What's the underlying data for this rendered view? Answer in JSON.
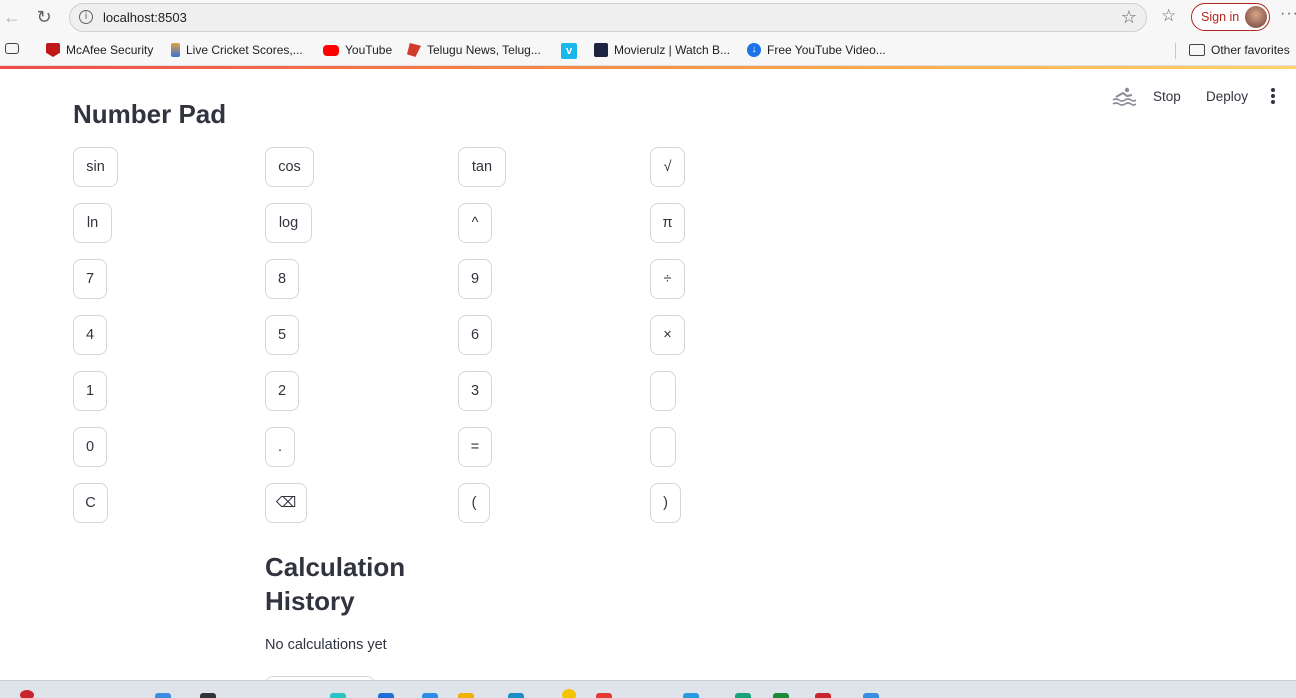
{
  "browser": {
    "url": "localhost:8503",
    "sign_in": "Sign in",
    "bookmarks": [
      {
        "label": "McAfee Security",
        "icon": "mcafee-icon",
        "color": "#c01818"
      },
      {
        "label": "Live Cricket Scores,...",
        "icon": "cricket-icon",
        "color": "#3b6fd8"
      },
      {
        "label": "YouTube",
        "icon": "youtube-icon",
        "color": "#ff0000"
      },
      {
        "label": "Telugu News, Telug...",
        "icon": "news-icon",
        "color": "#d23a2b"
      },
      {
        "label": "",
        "icon": "vimeo-icon",
        "color": "#1ab7ea"
      },
      {
        "label": "Movierulz | Watch B...",
        "icon": "movie-icon",
        "color": "#1c2340"
      },
      {
        "label": "Free YouTube Video...",
        "icon": "download-icon",
        "color": "#1a73e8"
      }
    ],
    "other_favorites": "Other favorites"
  },
  "toolbar": {
    "stop": "Stop",
    "deploy": "Deploy"
  },
  "page": {
    "title": "Number Pad",
    "history_title_line1": "Calculation",
    "history_title_line2": "History",
    "history_empty": "No calculations yet"
  },
  "keys": [
    [
      "sin",
      "cos",
      "tan",
      "√"
    ],
    [
      "ln",
      "log",
      "^",
      "π"
    ],
    [
      "7",
      "8",
      "9",
      "÷"
    ],
    [
      "4",
      "5",
      "6",
      "×"
    ],
    [
      "1",
      "2",
      "3",
      ""
    ],
    [
      "0",
      ".",
      "=",
      ""
    ],
    [
      "C",
      "⌫",
      "(",
      ")"
    ]
  ]
}
